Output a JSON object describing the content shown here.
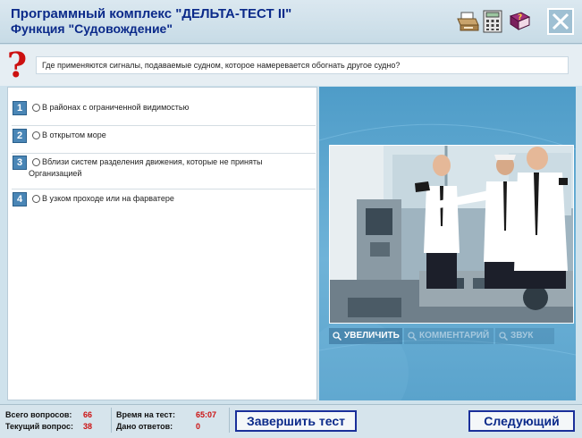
{
  "header": {
    "app_title": "Программный комплекс \"ДЕЛЬТА-ТЕСТ II\"",
    "function_title": "Функция \"Судовождение\"",
    "icons": [
      "printer-icon",
      "calculator-icon",
      "help-book-icon",
      "close-icon"
    ]
  },
  "question": {
    "text": "Где применяются сигналы, подаваемые судном, которое намеревается обогнать другое судно?"
  },
  "answers": [
    {
      "number": "1",
      "text": "В районах с ограниченной видимостью",
      "selected": false
    },
    {
      "number": "2",
      "text": "В открытом море",
      "selected": false
    },
    {
      "number": "3",
      "text": "Вблизи систем разделения движения, которые не приняты Организацией",
      "selected": false
    },
    {
      "number": "4",
      "text": "В узком проходе или на фарватере",
      "selected": false
    }
  ],
  "image_panel": {
    "controls": {
      "zoom": "УВЕЛИЧИТЬ",
      "comment": "КОММЕНТАРИЙ",
      "sound": "ЗВУК"
    }
  },
  "footer": {
    "total_questions_label": "Всего вопросов:",
    "total_questions_value": "66",
    "current_question_label": "Текущий вопрос:",
    "current_question_value": "38",
    "test_time_label": "Время на тест:",
    "test_time_value": "65:07",
    "answers_given_label": "Дано ответов:",
    "answers_given_value": "0",
    "finish_button": "Завершить тест",
    "next_button": "Следующий"
  },
  "colors": {
    "title_blue": "#0b2a8a",
    "accent_red": "#cc1010",
    "panel_blue": "#5aa3cc"
  }
}
